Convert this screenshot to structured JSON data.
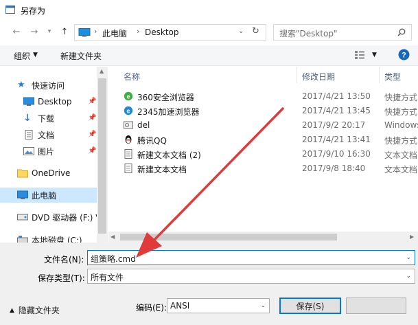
{
  "window": {
    "title": "另存为"
  },
  "nav": {
    "path_root": "此电脑",
    "path_leaf": "Desktop",
    "search_placeholder": "搜索\"Desktop\""
  },
  "toolbar": {
    "organize_label": "组织",
    "new_folder_label": "新建文件夹"
  },
  "sidebar": {
    "items": [
      {
        "label": "快速访问"
      },
      {
        "label": "Desktop"
      },
      {
        "label": "下载"
      },
      {
        "label": "文档"
      },
      {
        "label": "图片"
      },
      {
        "label": "OneDrive"
      },
      {
        "label": "此电脑"
      },
      {
        "label": "DVD 驱动器 (F:) V"
      },
      {
        "label": "本地磁盘 (C:)"
      }
    ]
  },
  "columns": {
    "name": "名称",
    "date": "修改日期",
    "type": "类型"
  },
  "files": [
    {
      "name": "360安全浏览器",
      "date": "2017/4/21 13:50",
      "type": "快捷方式"
    },
    {
      "name": "2345加速浏览器",
      "date": "2017/4/21 13:45",
      "type": "快捷方式"
    },
    {
      "name": "del",
      "date": "2017/9/2 20:17",
      "type": "Windows"
    },
    {
      "name": "腾讯QQ",
      "date": "2017/4/21 13:41",
      "type": "快捷方式"
    },
    {
      "name": "新建文本文档 (2)",
      "date": "2017/9/10 16:30",
      "type": "文本文档"
    },
    {
      "name": "新建文本文档",
      "date": "2017/9/8 18:40",
      "type": "文本文档"
    }
  ],
  "form": {
    "filename_label": "文件名(N):",
    "filename_value": "组策略.cmd",
    "filetype_label": "保存类型(T):",
    "filetype_value": "所有文件",
    "hide_folders_label": "隐藏文件夹",
    "encoding_label": "编码(E):",
    "encoding_value": "ANSI",
    "save_label": "保存(S)"
  },
  "colors": {
    "accent": "#0078d7",
    "header_text": "#4c607a",
    "arrow": "#e03a3a"
  }
}
